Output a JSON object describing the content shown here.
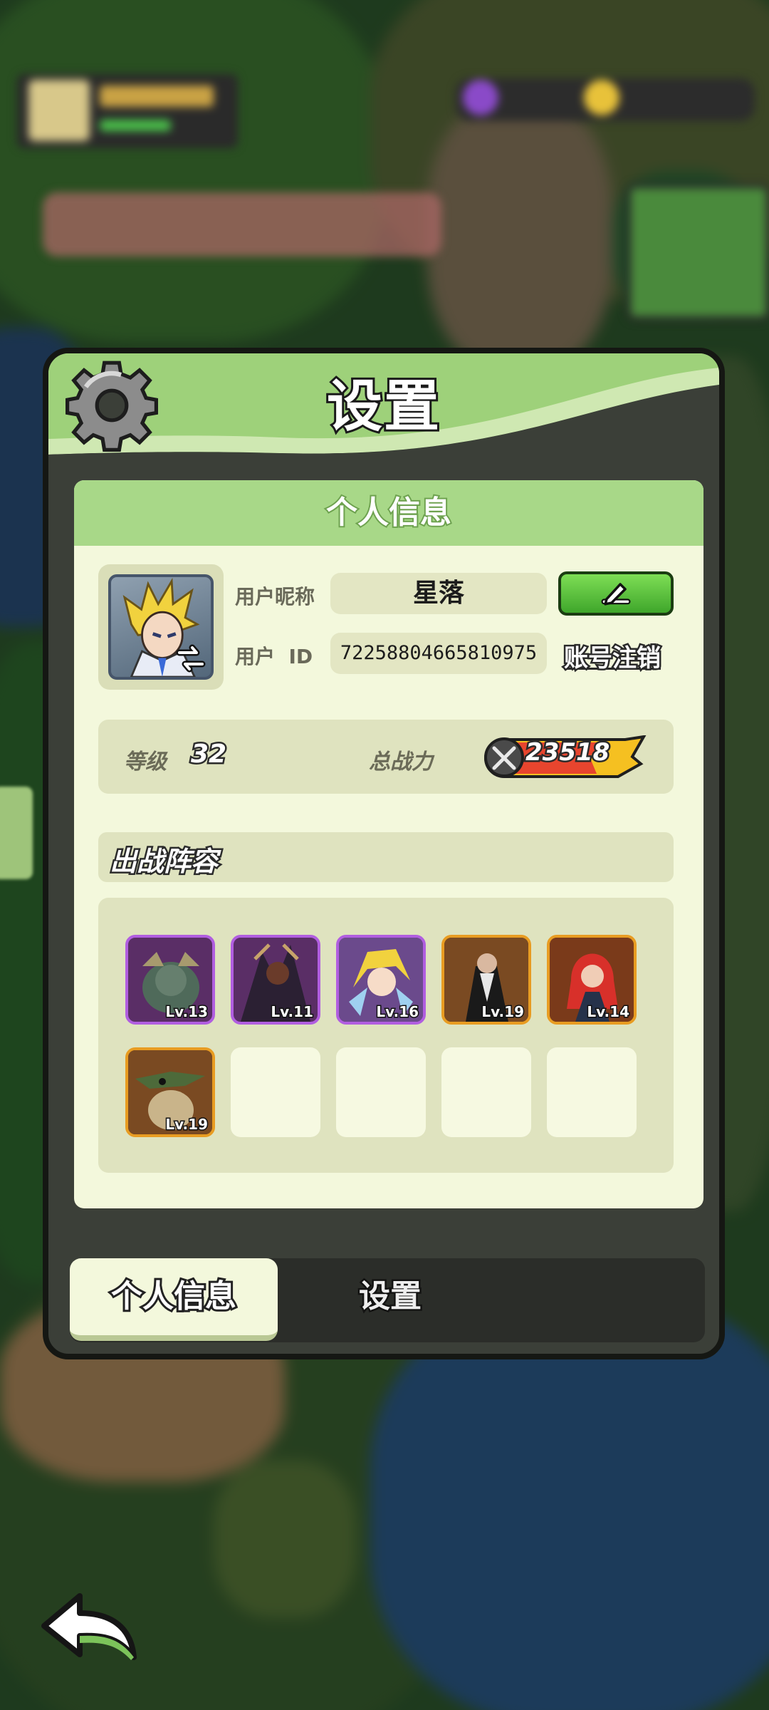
{
  "dialog": {
    "title": "设置"
  },
  "profile_card": {
    "header": "个人信息",
    "nickname_label": "用户昵称",
    "nickname_value": "星落",
    "id_label": "用户  ID",
    "id_value": "72258804665810975",
    "deregister_label": "账号注销"
  },
  "stats": {
    "level_label": "等级",
    "level_value": "32",
    "power_label": "总战力",
    "power_value": "23518"
  },
  "lineup": {
    "title": "出战阵容",
    "heroes": [
      {
        "level": "Lv.13",
        "rarity": "purple"
      },
      {
        "level": "Lv.11",
        "rarity": "purple"
      },
      {
        "level": "Lv.16",
        "rarity": "purple"
      },
      {
        "level": "Lv.19",
        "rarity": "orange"
      },
      {
        "level": "Lv.14",
        "rarity": "orange"
      },
      {
        "level": "Lv.19",
        "rarity": "orange"
      }
    ],
    "empty_slots": 4
  },
  "tabs": {
    "active": "个人信息",
    "inactive": "设置"
  },
  "colors": {
    "header_green": "#9ed17a",
    "card_bg": "#f3f8dc",
    "panel_bg": "#dfe3bf",
    "edit_green": "#5cc43a",
    "purple_rarity": "#b15ee0",
    "orange_rarity": "#e89c22",
    "power_gold": "#f5c021"
  },
  "icons": {
    "settings": "gear-icon",
    "edit": "pencil-icon",
    "swap": "swap-arrows-icon",
    "power": "crossed-swords-icon",
    "back": "back-arrow-icon"
  }
}
